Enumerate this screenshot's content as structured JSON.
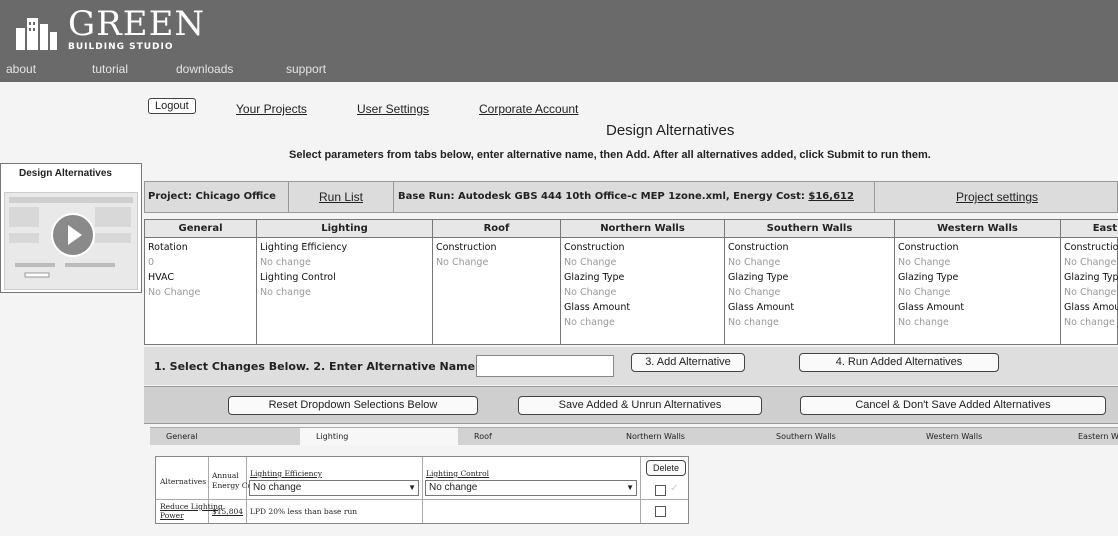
{
  "brand": {
    "name": "GREEN",
    "sub": "BUILDING STUDIO",
    "logo_icon": "city-buildings-icon"
  },
  "nav": [
    "about",
    "tutorial",
    "downloads",
    "support"
  ],
  "top_links": {
    "logout": "Logout",
    "your_projects": "Your Projects",
    "user_settings": "User Settings",
    "corporate_account": "Corporate Account"
  },
  "page_title": "Design Alternatives",
  "instructions": "Select parameters from tabs below, enter alternative name, then Add. After all alternatives added, click Submit to run them.",
  "side_panel": {
    "title": "Design Alternatives",
    "video_icon": "play-icon"
  },
  "project_bar": {
    "project": "Project: Chicago Office",
    "run_list": "Run List",
    "base_run_prefix": "Base Run: Autodesk GBS 444 10th Office-c MEP 1zone.xml, Energy Cost: ",
    "energy_cost": "$16,612",
    "project_settings": "Project settings"
  },
  "summary": {
    "general": {
      "title": "General",
      "items": [
        [
          "Rotation",
          "0"
        ],
        [
          "HVAC",
          "No Change"
        ]
      ]
    },
    "lighting": {
      "title": "Lighting",
      "items": [
        [
          "Lighting Efficiency",
          "No change"
        ],
        [
          "Lighting Control",
          "No change"
        ]
      ]
    },
    "roof": {
      "title": "Roof",
      "items": [
        [
          "Construction",
          "No Change"
        ]
      ]
    },
    "northern": {
      "title": "Northern Walls",
      "items": [
        [
          "Construction",
          "No Change"
        ],
        [
          "Glazing Type",
          "No Change"
        ],
        [
          "Glass Amount",
          "No change"
        ]
      ]
    },
    "southern": {
      "title": "Southern Walls",
      "items": [
        [
          "Construction",
          "No Change"
        ],
        [
          "Glazing Type",
          "No Change"
        ],
        [
          "Glass Amount",
          "No change"
        ]
      ]
    },
    "western": {
      "title": "Western Walls",
      "items": [
        [
          "Construction",
          "No Change"
        ],
        [
          "Glazing Type",
          "No Change"
        ],
        [
          "Glass Amount",
          "No change"
        ]
      ]
    },
    "eastern": {
      "title": "East",
      "items": [
        [
          "Constructio",
          "No Change"
        ],
        [
          "Glazing Typ",
          "No Change"
        ],
        [
          "Glass Amou",
          "No change"
        ]
      ]
    }
  },
  "actions": {
    "steps_text": "1. Select Changes Below.   2. Enter Alternative Name:",
    "alt_name_value": "",
    "add": "3. Add Alternative",
    "run": "4. Run Added Alternatives",
    "reset": "Reset Dropdown Selections Below",
    "save": "Save Added & Unrun Alternatives",
    "cancel": "Cancel & Don't Save Added Alternatives"
  },
  "tabs": [
    "General",
    "Lighting",
    "Roof",
    "Northern Walls",
    "Southern Walls",
    "Western Walls",
    "Eastern Wa"
  ],
  "active_tab": "Lighting",
  "detail": {
    "headers": {
      "alternatives": "Alternatives",
      "annual_cost_1": "Annual",
      "annual_cost_2": "Energy Cost",
      "lighting_efficiency": "Lighting Efficiency",
      "lighting_control": "Lighting Control",
      "delete": "Delete"
    },
    "select_efficiency": "No change",
    "select_control": "No change",
    "row": {
      "name_1": "Reduce Lighting",
      "name_2": "Power",
      "cost": "$15,804",
      "desc": "LPD 20% less than base run"
    }
  }
}
